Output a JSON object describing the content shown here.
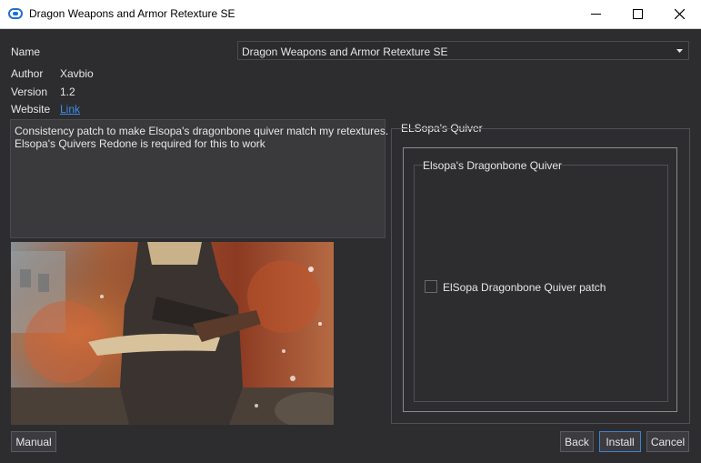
{
  "window": {
    "title": "Dragon Weapons and Armor Retexture SE",
    "app_icon": "app-logo-icon"
  },
  "info": {
    "name_label": "Name",
    "author_label": "Author",
    "author_value": "Xavbio",
    "version_label": "Version",
    "version_value": "1.2",
    "website_label": "Website",
    "website_link": "Link"
  },
  "module_select": {
    "selected": "Dragon Weapons and Armor Retexture SE"
  },
  "description": {
    "lines": [
      "Consistency patch to make Elsopa's dragonbone quiver match my retextures.",
      "Elsopa's Quivers Redone is required for this to work"
    ]
  },
  "options": {
    "step_title": "ELSopa's Quiver",
    "group_title": "Elsopa's Dragonbone Quiver",
    "option_label": "ElSopa Dragonbone Quiver patch",
    "option_checked": false
  },
  "buttons": {
    "manual": "Manual",
    "back": "Back",
    "install": "Install",
    "cancel": "Cancel"
  },
  "colors": {
    "background": "#2d2d30",
    "accent": "#3c82d4",
    "link": "#3b8ee8"
  }
}
